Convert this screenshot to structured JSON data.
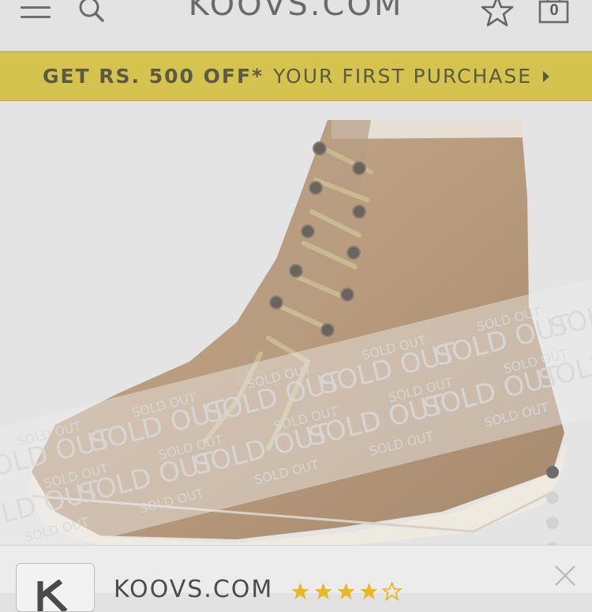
{
  "header": {
    "logo": "KOOVS.COM",
    "cart_count": "0",
    "icons": [
      "hamburger-menu-icon",
      "search-icon",
      "star-icon",
      "cart-icon"
    ]
  },
  "promo": {
    "bold_text": "GET RS. 500 OFF*",
    "light_text": "YOUR FIRST PURCHASE",
    "color": "#d4c34e"
  },
  "product": {
    "status_watermark": "SOLD OUT",
    "image_dots": 4,
    "active_dot": 0
  },
  "app_banner": {
    "name": "KOOVS.COM",
    "rating_stars": 4,
    "rating_max": 5,
    "star_color": "#e7b928"
  }
}
